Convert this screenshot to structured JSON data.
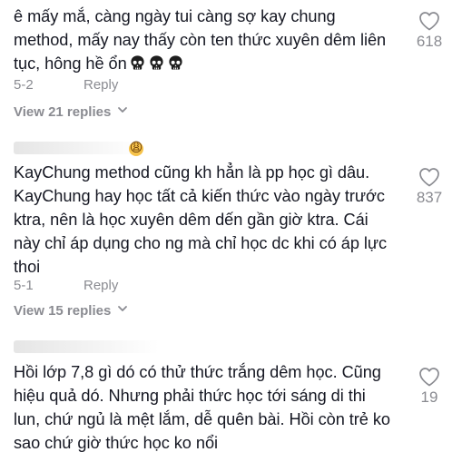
{
  "comments": [
    {
      "text": "ê mấy mắ, càng ngày tui càng sợ kay chung\nmethod, mấy nay thấy còn ten thức xuyên dêm liên\ntục, hông hề ổn",
      "date": "5-2",
      "reply_label": "Reply",
      "view_replies": "View 21 replies",
      "likes": "618",
      "emoji_icons": [
        "skull-icon",
        "skull-icon",
        "skull-icon"
      ]
    },
    {
      "text": "KayChung method cũng kh hẳn là pp học gì dâu.\nKayChung hay học tất cả kiến thức vào ngày trước\nktra, nên là học xuyên dêm dến gần giờ ktra. Cái\nnày chỉ áp dụng cho ng mà chỉ học dc khi có áp lực\nthoi",
      "date": "5-1",
      "reply_label": "Reply",
      "view_replies": "View 15 replies",
      "likes": "837",
      "username_emoji": "😩"
    },
    {
      "text": "Hồi lớp 7,8 gì dó có thử thức trắng dêm học. Cũng\nhiệu quả dó. Nhưng phải thức học tới sáng di thi\nlun, chứ ngủ là mệt lắm, dễ quên bài. Hồi còn trẻ ko\nsao chứ giờ thức học ko nổi",
      "likes": "19"
    }
  ],
  "colors": {
    "text": "#161823",
    "secondary": "#8a8b91",
    "background": "#ffffff"
  }
}
